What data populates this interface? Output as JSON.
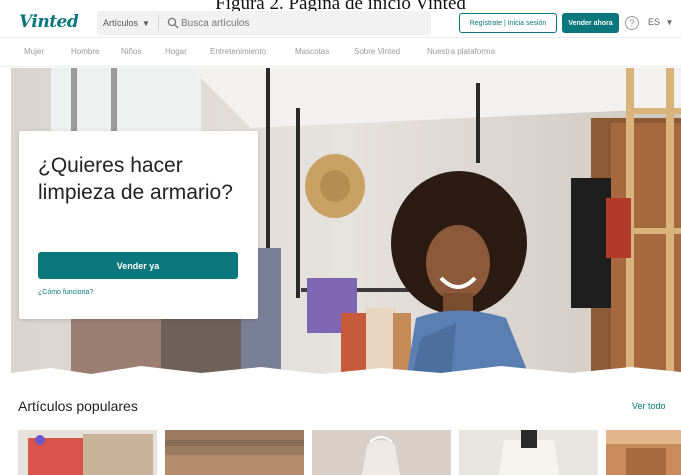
{
  "caption": "Figura 2. Página de inicio Vinted",
  "brand": {
    "name": "Vinted",
    "color": "#09777c"
  },
  "search": {
    "category": "Artículos",
    "placeholder": "Busca artículos"
  },
  "header": {
    "register_label": "Regístrate | Inicia sesión",
    "sell_label": "Vender ahora",
    "help_glyph": "?",
    "language": "ES"
  },
  "nav": {
    "items": [
      {
        "label": "Mujer"
      },
      {
        "label": "Hombre"
      },
      {
        "label": "Niños"
      },
      {
        "label": "Hogar"
      },
      {
        "label": "Entretenimiento"
      },
      {
        "label": "Mascotas"
      },
      {
        "label": "Sobre Vinted"
      },
      {
        "label": "Nuestra plataforma"
      }
    ]
  },
  "hero": {
    "title": "¿Quieres hacer limpieza de armario?",
    "cta_label": "Vender ya",
    "link_label": "¿Cómo funciona?"
  },
  "popular": {
    "title": "Artículos populares",
    "view_all": "Ver todo"
  }
}
